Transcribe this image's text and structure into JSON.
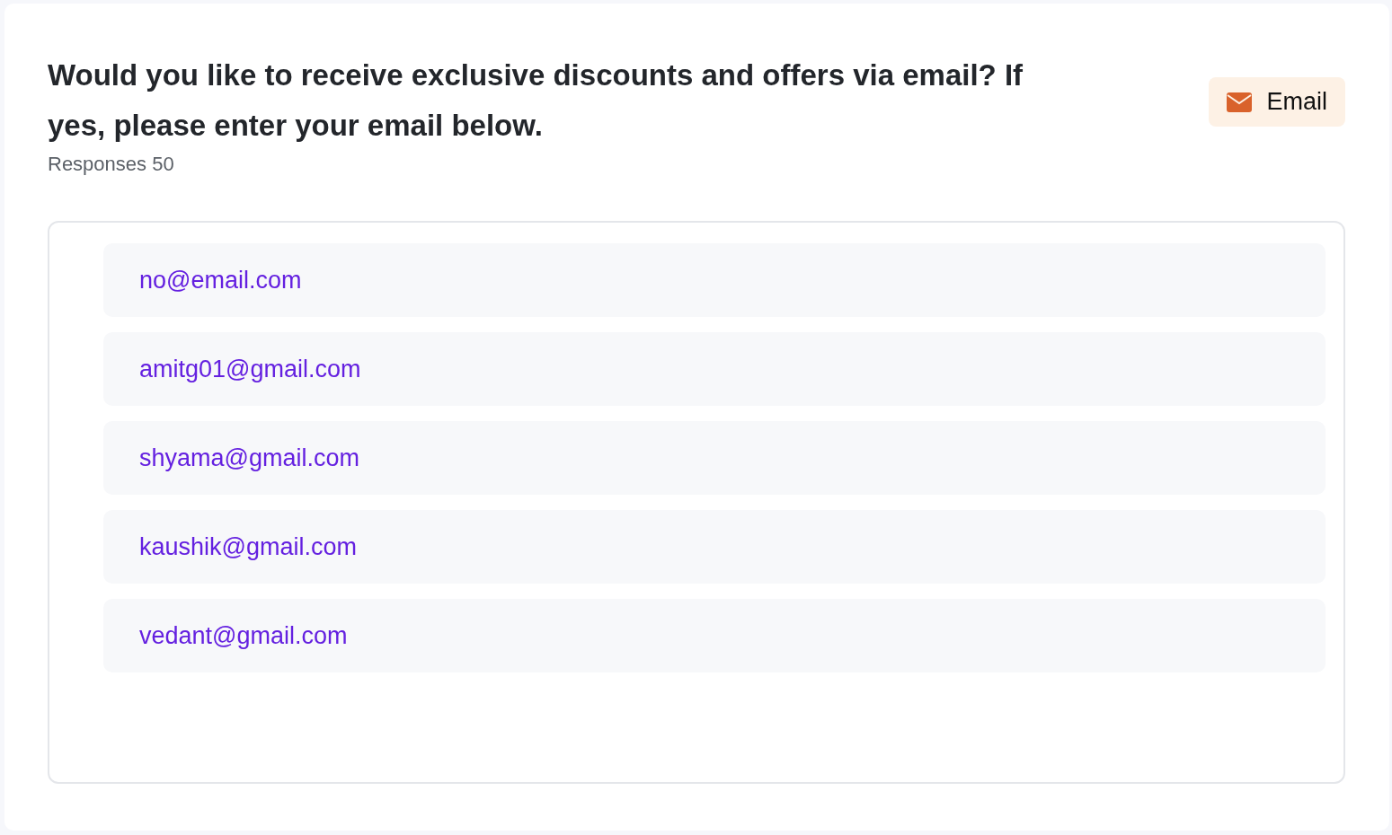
{
  "question": {
    "title": "Would you like to receive exclusive discounts and offers via email? If yes, please enter your email below.",
    "responses": "Responses 50",
    "badge": {
      "label": "Email",
      "kind": "email"
    }
  },
  "answers": [
    "no@email.com",
    "amitg01@gmail.com",
    "shyama@gmail.com",
    "kaushik@gmail.com",
    "vedant@gmail.com"
  ]
}
